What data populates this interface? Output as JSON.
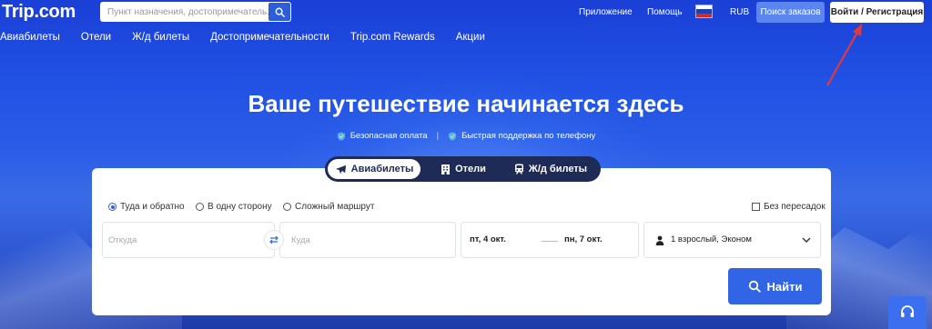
{
  "header": {
    "logo": "Trip.com",
    "search_placeholder": "Пункт назначения, достопримечатель...",
    "links": {
      "app": "Приложение",
      "help": "Помощь",
      "currency": "RUB"
    },
    "orders_button": "Поиск заказов",
    "login_button": "Войти / Регистрация"
  },
  "nav": {
    "items": [
      {
        "label": "Авиабилеты"
      },
      {
        "label": "Отели"
      },
      {
        "label": "Ж/д билеты"
      },
      {
        "label": "Достопримечательности"
      },
      {
        "label": "Trip.com Rewards"
      },
      {
        "label": "Акции"
      }
    ]
  },
  "hero": {
    "title": "Ваше путешествие начинается здесь",
    "features": [
      "Безопасная оплата",
      "Быстрая поддержка по телефону"
    ],
    "separator": "|"
  },
  "tabs": [
    {
      "label": "Авиабилеты",
      "icon": "plane-icon",
      "active": true
    },
    {
      "label": "Отели",
      "icon": "building-icon",
      "active": false
    },
    {
      "label": "Ж/д билеты",
      "icon": "train-icon",
      "active": false
    }
  ],
  "search_form": {
    "trip_types": [
      {
        "label": "Туда и обратно",
        "selected": true
      },
      {
        "label": "В одну сторону",
        "selected": false
      },
      {
        "label": "Сложный маршрут",
        "selected": false
      }
    ],
    "nonstop_label": "Без пересадок",
    "nonstop_checked": false,
    "from_placeholder": "Откуда",
    "to_placeholder": "Куда",
    "depart_date": "пт, 4 окт.",
    "return_date": "пн, 7 окт.",
    "passengers": "1 взрослый, Эконом",
    "search_button": "Найти"
  },
  "colors": {
    "accent": "#3264e6",
    "tabs_bg": "#1f2b57",
    "annotation_arrow": "#e53935"
  }
}
